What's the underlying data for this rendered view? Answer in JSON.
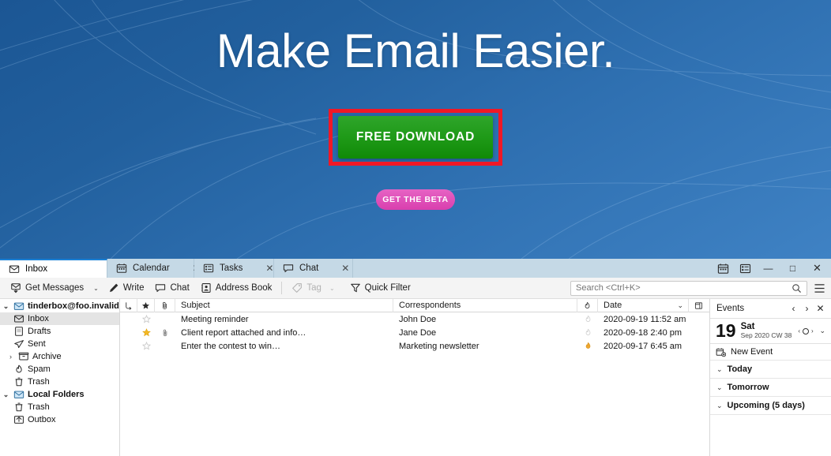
{
  "hero": {
    "title": "Make Email Easier.",
    "download_label": "FREE DOWNLOAD",
    "beta_label": "GET THE BETA",
    "colors": {
      "bg_top": "#1b5694",
      "bg_bottom": "#3f82c4",
      "download_green": "#1f9a18",
      "highlight_red": "#f01826",
      "beta_pink": "#d93fae"
    }
  },
  "window": {
    "tabs": [
      {
        "label": "Inbox",
        "icon": "inbox-icon",
        "active": true,
        "closable": false
      },
      {
        "label": "Calendar",
        "icon": "calendar-icon",
        "active": false,
        "closable": true
      },
      {
        "label": "Tasks",
        "icon": "tasks-icon",
        "active": false,
        "closable": true
      },
      {
        "label": "Chat",
        "icon": "chat-icon",
        "active": false,
        "closable": true
      }
    ],
    "titlebar_buttons": [
      {
        "name": "calendar-icon",
        "label": ""
      },
      {
        "name": "tasks-icon",
        "label": ""
      }
    ],
    "controls": {
      "minimize": "—",
      "maximize": "□",
      "close": "✕"
    }
  },
  "toolbar": {
    "get_messages": "Get Messages",
    "get_messages_caret": "⌄",
    "write": "Write",
    "chat": "Chat",
    "address_book": "Address Book",
    "tag": "Tag",
    "tag_caret": "⌄",
    "quick_filter": "Quick Filter",
    "search_placeholder": "Search <Ctrl+K>"
  },
  "folders": [
    {
      "label": "tinderbox@foo.invalid",
      "icon": "account-icon",
      "twisty": "⌄",
      "level": 0,
      "bold": true,
      "selected": false
    },
    {
      "label": "Inbox",
      "icon": "inbox-icon",
      "twisty": "",
      "level": 1,
      "bold": false,
      "selected": true
    },
    {
      "label": "Drafts",
      "icon": "drafts-icon",
      "twisty": "",
      "level": 1,
      "bold": false,
      "selected": false
    },
    {
      "label": "Sent",
      "icon": "sent-icon",
      "twisty": "",
      "level": 1,
      "bold": false,
      "selected": false
    },
    {
      "label": "Archive",
      "icon": "archive-icon",
      "twisty": "›",
      "level": 1,
      "bold": false,
      "selected": false
    },
    {
      "label": "Spam",
      "icon": "spam-icon",
      "twisty": "",
      "level": 1,
      "bold": false,
      "selected": false
    },
    {
      "label": "Trash",
      "icon": "trash-icon",
      "twisty": "",
      "level": 1,
      "bold": false,
      "selected": false
    },
    {
      "label": "Local Folders",
      "icon": "account-icon",
      "twisty": "⌄",
      "level": 0,
      "bold": true,
      "selected": false
    },
    {
      "label": "Trash",
      "icon": "trash-icon",
      "twisty": "",
      "level": 1,
      "bold": false,
      "selected": false
    },
    {
      "label": "Outbox",
      "icon": "outbox-icon",
      "twisty": "",
      "level": 1,
      "bold": false,
      "selected": false
    }
  ],
  "messages": {
    "columns": {
      "thread": "thread-icon",
      "star": "star-icon",
      "attachment": "attachment-icon",
      "subject": "Subject",
      "correspondents": "Correspondents",
      "junk": "junk-icon",
      "date": "Date",
      "sort_caret": "⌄",
      "column_picker": "column-picker-icon"
    },
    "rows": [
      {
        "subject": "Meeting reminder",
        "correspondent": "John Doe",
        "date": "2020-09-19 11:52 am",
        "starred": false,
        "attachment": false,
        "junk": false
      },
      {
        "subject": "Client report attached and info…",
        "correspondent": "Jane Doe",
        "date": "2020-09-18 2:40 pm",
        "starred": true,
        "attachment": true,
        "junk": false
      },
      {
        "subject": "Enter the contest to win…",
        "correspondent": "Marketing newsletter",
        "date": "2020-09-17 6:45 am",
        "starred": false,
        "attachment": false,
        "junk": true
      }
    ]
  },
  "events": {
    "title": "Events",
    "prev": "‹",
    "next": "›",
    "close": "✕",
    "day_number": "19",
    "day_of_week": "Sat",
    "date_sub": "Sep 2020 CW 38",
    "mini_prev": "‹",
    "mini_next": "›",
    "expand_caret": "⌄",
    "new_event": "New Event",
    "sections": [
      {
        "label": "Today",
        "twisty": "⌄"
      },
      {
        "label": "Tomorrow",
        "twisty": "⌄"
      },
      {
        "label": "Upcoming (5 days)",
        "twisty": "⌄"
      }
    ]
  }
}
